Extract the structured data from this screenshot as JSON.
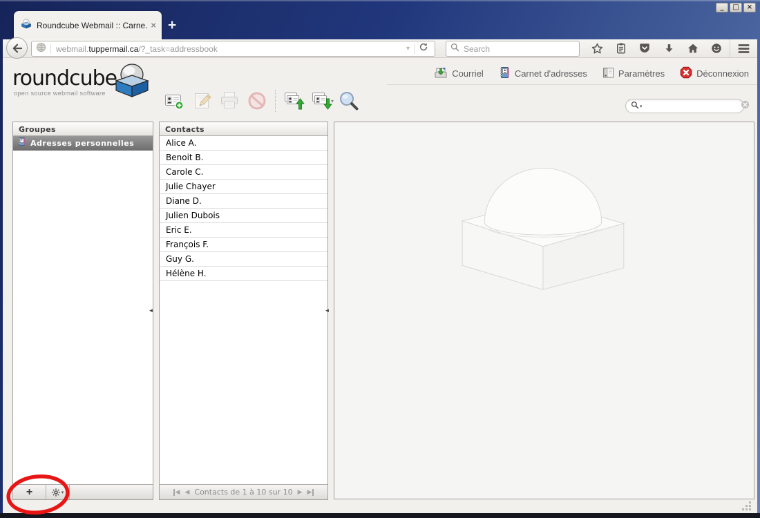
{
  "window": {
    "controls": {
      "minimize": "_",
      "maximize": "□",
      "close": "×"
    }
  },
  "browser": {
    "tab_title": "Roundcube Webmail :: Carne...",
    "tab_close": "×",
    "new_tab": "+",
    "url_prefix": "webmail.",
    "url_domain": "tuppermail.ca",
    "url_path": "/?_task=addressbook",
    "url_dropdown": "▾",
    "search_placeholder": "Search"
  },
  "app": {
    "logo_text": "roundcube",
    "logo_tagline": "open source webmail software",
    "taskbar": {
      "mail": "Courriel",
      "addressbook": "Carnet d'adresses",
      "settings": "Paramètres",
      "logout": "Déconnexion"
    },
    "toolbar": {
      "export_dropdown": "▾"
    },
    "search_caret": "▾"
  },
  "groups": {
    "header": "Groupes",
    "selected_item": "Adresses personnelles",
    "add_button": "+",
    "gear_dropdown": "▾"
  },
  "contacts": {
    "header": "Contacts",
    "rows": [
      "Alice A.",
      "Benoit B.",
      "Carole C.",
      "Julie Chayer",
      "Diane D.",
      "Julien Dubois",
      "Eric E.",
      "François F.",
      "Guy G.",
      "Hélène H."
    ],
    "pagination": {
      "first": "◀",
      "prev": "◀",
      "label": "Contacts de 1 à 10 sur 10",
      "next": "▶",
      "last": "▶"
    }
  },
  "splitters": {
    "groups": "◄",
    "contacts": "◄"
  },
  "colors": {
    "titlebar_blue": "#21377c",
    "selected_gray": "#7d7d7d",
    "annotation_red": "#e81515",
    "action_green": "#2fa32f",
    "logout_red": "#d93030"
  }
}
